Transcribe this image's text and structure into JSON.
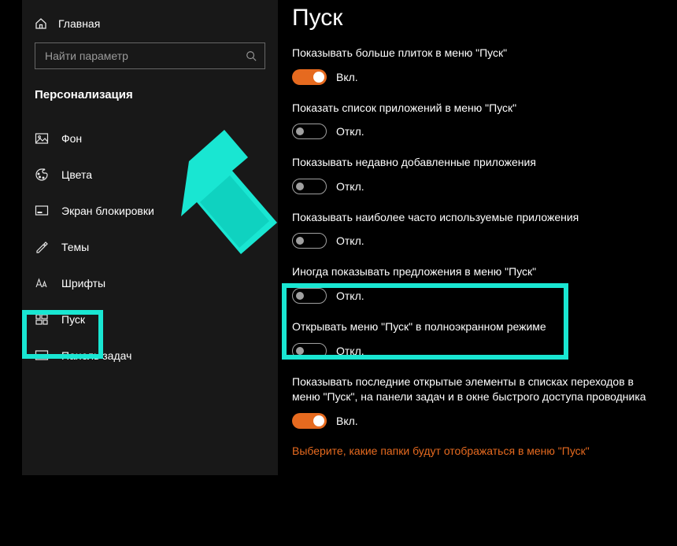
{
  "sidebar": {
    "home_label": "Главная",
    "search_placeholder": "Найти параметр",
    "section_title": "Персонализация",
    "items": [
      {
        "label": "Фон"
      },
      {
        "label": "Цвета"
      },
      {
        "label": "Экран блокировки"
      },
      {
        "label": "Темы"
      },
      {
        "label": "Шрифты"
      },
      {
        "label": "Пуск"
      },
      {
        "label": "Панель задач"
      }
    ]
  },
  "main": {
    "page_title": "Пуск",
    "on_label": "Вкл.",
    "off_label": "Откл.",
    "settings": [
      {
        "caption": "Показывать больше плиток в меню \"Пуск\"",
        "on": true
      },
      {
        "caption": "Показать список приложений в меню \"Пуск\"",
        "on": false
      },
      {
        "caption": "Показывать недавно добавленные приложения",
        "on": false
      },
      {
        "caption": "Показывать наиболее часто используемые приложения",
        "on": false
      },
      {
        "caption": "Иногда показывать предложения в меню \"Пуск\"",
        "on": false
      },
      {
        "caption": "Открывать меню \"Пуск\" в полноэкранном режиме",
        "on": false
      },
      {
        "caption": "Показывать последние открытые элементы в списках переходов в меню \"Пуск\", на панели задач и в окне быстрого доступа проводника",
        "on": true
      }
    ],
    "link_text": "Выберите, какие папки будут отображаться в меню \"Пуск\""
  },
  "colors": {
    "accent": "#e66a1f",
    "highlight": "#19e6d2"
  }
}
